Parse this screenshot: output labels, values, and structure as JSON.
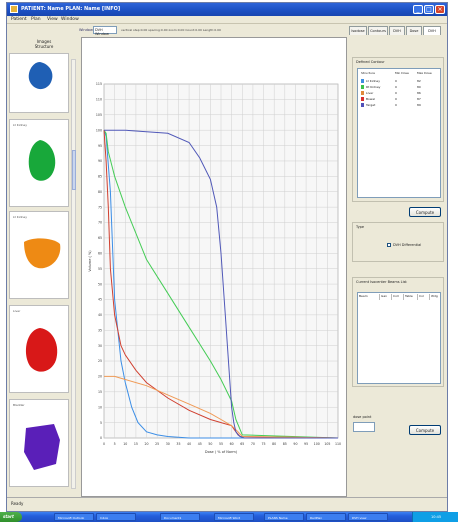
{
  "window": {
    "title": "PATIENT: Name     PLAN: Name  [INFO]",
    "menu": [
      "Patient",
      "Plan",
      "View",
      "Window"
    ]
  },
  "toolbar": {
    "view_label": "Window",
    "selector_value": "DVH Window",
    "params_text": "vertical step:0.00 spacing:0.00 zoom:0.00 Count:0.00 Length:0.00"
  },
  "tabs": [
    "Isodose",
    "Contours",
    "DVH",
    "Dose",
    "DVH"
  ],
  "left_panel": {
    "header": "Images\nStructure",
    "thumbnails": [
      {
        "label": "",
        "color": "#1f5fb4"
      },
      {
        "label": "Lt Kidney",
        "color": "#18a83a"
      },
      {
        "label": "Lt Kidney",
        "color": "#ee8a14"
      },
      {
        "label": "Liver",
        "color": "#d81818"
      },
      {
        "label": "Bladder",
        "color": "#5a1fb8"
      }
    ]
  },
  "contours_panel": {
    "title": "Defined Contour",
    "columns": [
      "Structure",
      "Min Dose",
      "Max Dose"
    ],
    "rows": [
      {
        "name": "Lt Kidney",
        "min": "0",
        "max": "82",
        "color": "#3f8ee0"
      },
      {
        "name": "Rt Kidney",
        "min": "0",
        "max": "80",
        "color": "#3cc24a"
      },
      {
        "name": "Liver",
        "min": "0",
        "max": "86",
        "color": "#e08a3c"
      },
      {
        "name": "Bowel",
        "min": "0",
        "max": "87",
        "color": "#d83030"
      },
      {
        "name": "Target",
        "min": "0",
        "max": "89",
        "color": "#5050b8"
      }
    ],
    "compute_label": "Compute"
  },
  "type_panel": {
    "title": "Type",
    "option_label": "DVH Differential"
  },
  "beams_panel": {
    "title": "Current Isocenter Beams List",
    "columns": [
      "Beam",
      "Gan",
      "Coll",
      "Table",
      "Col",
      "Wdg"
    ]
  },
  "dose_point": {
    "label": "dose point",
    "compute_label": "Compute"
  },
  "status": "Ready",
  "taskbar": {
    "start": "start",
    "items": [
      "Microsoft Outlook",
      "Inbox",
      "Document1",
      "Microsoft Word",
      "PLANS Name",
      "RadPlan",
      "DVH view"
    ],
    "clock": "10:45"
  },
  "chart_data": {
    "type": "line",
    "xlabel": "Dose ( % of Norm)",
    "ylabel": "Volume ( %)",
    "xlim": [
      0,
      110
    ],
    "ylim": [
      0,
      115
    ],
    "x_ticks": [
      0,
      5,
      10,
      15,
      20,
      25,
      30,
      35,
      40,
      45,
      50,
      55,
      60,
      65,
      70,
      75,
      80,
      85,
      90,
      95,
      100,
      105,
      110
    ],
    "y_ticks": [
      0,
      5,
      10,
      15,
      20,
      25,
      30,
      35,
      40,
      45,
      50,
      55,
      60,
      65,
      70,
      75,
      80,
      85,
      90,
      95,
      100,
      105,
      110,
      115
    ],
    "grid": true,
    "series": [
      {
        "color": "#3c8ee6",
        "x": [
          0,
          1,
          3,
          5,
          8,
          10,
          13,
          16,
          20,
          25,
          30,
          40,
          110
        ],
        "y": [
          100,
          98,
          80,
          45,
          25,
          18,
          10,
          5,
          2,
          1,
          0.5,
          0,
          0
        ]
      },
      {
        "color": "#44cc55",
        "x": [
          0,
          1,
          2,
          5,
          10,
          20,
          30,
          40,
          50,
          55,
          60,
          62,
          65,
          110
        ],
        "y": [
          100,
          99,
          93,
          85,
          75,
          58,
          47,
          36,
          25,
          19,
          12,
          6,
          1,
          0
        ]
      },
      {
        "color": "#d04030",
        "x": [
          0,
          1,
          2,
          3,
          5,
          8,
          10,
          15,
          20,
          30,
          40,
          50,
          60,
          62,
          64,
          110
        ],
        "y": [
          100,
          90,
          75,
          55,
          40,
          30,
          27,
          22,
          18,
          13,
          9,
          6,
          4,
          2,
          0.5,
          0
        ]
      },
      {
        "color": "#f09a55",
        "x": [
          0,
          1,
          3,
          5,
          10,
          20,
          30,
          40,
          50,
          55,
          60,
          63,
          65,
          110
        ],
        "y": [
          20,
          20,
          20,
          20,
          19,
          17,
          14,
          11,
          8,
          6,
          4,
          2,
          0.5,
          0
        ]
      },
      {
        "color": "#5058b8",
        "x": [
          0,
          2,
          10,
          20,
          30,
          40,
          45,
          50,
          53,
          55,
          57,
          59,
          60,
          61,
          62,
          63,
          64,
          66,
          110
        ],
        "y": [
          100,
          100,
          100,
          99.5,
          99,
          96,
          91,
          84,
          75,
          60,
          40,
          20,
          10,
          5,
          2,
          1,
          0.5,
          0,
          0
        ]
      }
    ]
  }
}
